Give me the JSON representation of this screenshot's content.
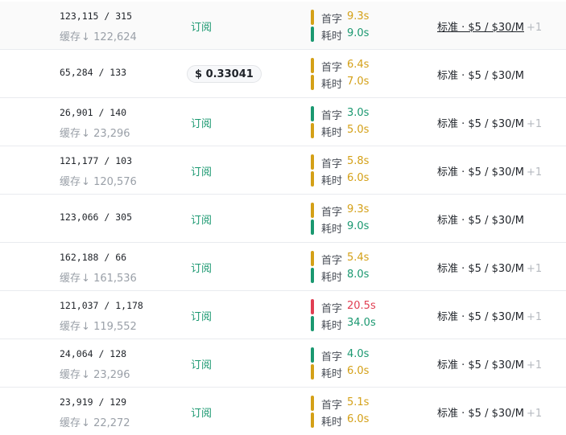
{
  "colors": {
    "green": "#1a9870",
    "yellow": "#d4a017",
    "red": "#e03e52",
    "gray": "#9aa0a8"
  },
  "rows": [
    {
      "tokens": "123,115 / 315",
      "cache_label": "缓存",
      "cache_arrow": "↓",
      "cache_value": "122,624",
      "billing": "订阅",
      "ttft_label": "首字",
      "ttft_value": "9.3s",
      "ttft_color": "yellow",
      "total_label": "耗时",
      "total_value": "9.0s",
      "total_color": "green",
      "price": "标准 · $5 / $30/M",
      "price_extra": "+1"
    },
    {
      "tokens": "65,284 / 133",
      "cost": "$ 0.33041",
      "ttft_label": "首字",
      "ttft_value": "6.4s",
      "ttft_color": "yellow",
      "total_label": "耗时",
      "total_value": "7.0s",
      "total_color": "yellow",
      "price": "标准 · $5 / $30/M"
    },
    {
      "tokens": "26,901 / 140",
      "cache_label": "缓存",
      "cache_arrow": "↓",
      "cache_value": "23,296",
      "billing": "订阅",
      "ttft_label": "首字",
      "ttft_value": "3.0s",
      "ttft_color": "green",
      "total_label": "耗时",
      "total_value": "5.0s",
      "total_color": "yellow",
      "price": "标准 · $5 / $30/M",
      "price_extra": "+1"
    },
    {
      "tokens": "121,177 / 103",
      "cache_label": "缓存",
      "cache_arrow": "↓",
      "cache_value": "120,576",
      "billing": "订阅",
      "ttft_label": "首字",
      "ttft_value": "5.8s",
      "ttft_color": "yellow",
      "total_label": "耗时",
      "total_value": "6.0s",
      "total_color": "yellow",
      "price": "标准 · $5 / $30/M",
      "price_extra": "+1"
    },
    {
      "tokens": "123,066 / 305",
      "billing": "订阅",
      "ttft_label": "首字",
      "ttft_value": "9.3s",
      "ttft_color": "yellow",
      "total_label": "耗时",
      "total_value": "9.0s",
      "total_color": "green",
      "price": "标准 · $5 / $30/M"
    },
    {
      "tokens": "162,188 / 66",
      "cache_label": "缓存",
      "cache_arrow": "↓",
      "cache_value": "161,536",
      "billing": "订阅",
      "ttft_label": "首字",
      "ttft_value": "5.4s",
      "ttft_color": "yellow",
      "total_label": "耗时",
      "total_value": "8.0s",
      "total_color": "green",
      "price": "标准 · $5 / $30/M",
      "price_extra": "+1"
    },
    {
      "tokens": "121,037 / 1,178",
      "cache_label": "缓存",
      "cache_arrow": "↓",
      "cache_value": "119,552",
      "billing": "订阅",
      "ttft_label": "首字",
      "ttft_value": "20.5s",
      "ttft_color": "red",
      "total_label": "耗时",
      "total_value": "34.0s",
      "total_color": "green",
      "price": "标准 · $5 / $30/M",
      "price_extra": "+1"
    },
    {
      "tokens": "24,064 / 128",
      "cache_label": "缓存",
      "cache_arrow": "↓",
      "cache_value": "23,296",
      "billing": "订阅",
      "ttft_label": "首字",
      "ttft_value": "4.0s",
      "ttft_color": "green",
      "total_label": "耗时",
      "total_value": "6.0s",
      "total_color": "yellow",
      "price": "标准 · $5 / $30/M",
      "price_extra": "+1"
    },
    {
      "tokens": "23,919 / 129",
      "cache_label": "缓存",
      "cache_arrow": "↓",
      "cache_value": "22,272",
      "billing": "订阅",
      "ttft_label": "首字",
      "ttft_value": "5.1s",
      "ttft_color": "yellow",
      "total_label": "耗时",
      "total_value": "6.0s",
      "total_color": "yellow",
      "price": "标准 · $5 / $30/M",
      "price_extra": "+1"
    }
  ]
}
